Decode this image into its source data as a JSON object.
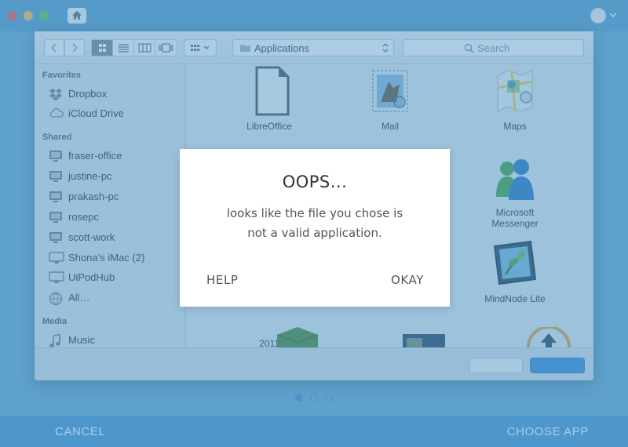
{
  "dialog": {
    "location": "Applications",
    "search_placeholder": "Search"
  },
  "sidebar": {
    "sections": [
      {
        "heading": "Favorites",
        "items": [
          {
            "label": "Dropbox",
            "icon": "dropbox-icon"
          },
          {
            "label": "iCloud Drive",
            "icon": "cloud-icon"
          }
        ]
      },
      {
        "heading": "Shared",
        "items": [
          {
            "label": "fraser-office",
            "icon": "monitor-icon"
          },
          {
            "label": "justine-pc",
            "icon": "monitor-icon"
          },
          {
            "label": "prakash-pc",
            "icon": "monitor-icon"
          },
          {
            "label": "rosepc",
            "icon": "monitor-icon"
          },
          {
            "label": "scott-work",
            "icon": "monitor-icon"
          },
          {
            "label": "Shona’s iMac (2)",
            "icon": "imac-icon"
          },
          {
            "label": "UiPodHub",
            "icon": "imac-icon"
          },
          {
            "label": "All…",
            "icon": "network-globe-icon"
          }
        ]
      },
      {
        "heading": "Media",
        "items": [
          {
            "label": "Music",
            "icon": "music-note-icon"
          }
        ]
      }
    ]
  },
  "files": [
    {
      "label": "LibreOffice",
      "icon": "libreoffice-icon"
    },
    {
      "label": "Mail",
      "icon": "mail-stamp-icon"
    },
    {
      "label": "Maps",
      "icon": "maps-icon"
    },
    {
      "label": "Microsoft Messenger",
      "icon": "messenger-icon"
    },
    {
      "label": "MindNode Lite",
      "icon": "mindnode-icon"
    },
    {
      "label": "2011",
      "icon": ""
    }
  ],
  "alert": {
    "title": "OOPS...",
    "message_line1": "looks like the file you chose is",
    "message_line2": "not a valid application.",
    "help_label": "HELP",
    "okay_label": "OKAY"
  },
  "pager": {
    "count": 3,
    "active_index": 0
  },
  "bottom": {
    "cancel_label": "CANCEL",
    "choose_label": "CHOOSE APP"
  },
  "colors": {
    "overlay": "#5096c8",
    "bottom_bar": "#4e97cd",
    "accent": "#3d8fd6"
  }
}
